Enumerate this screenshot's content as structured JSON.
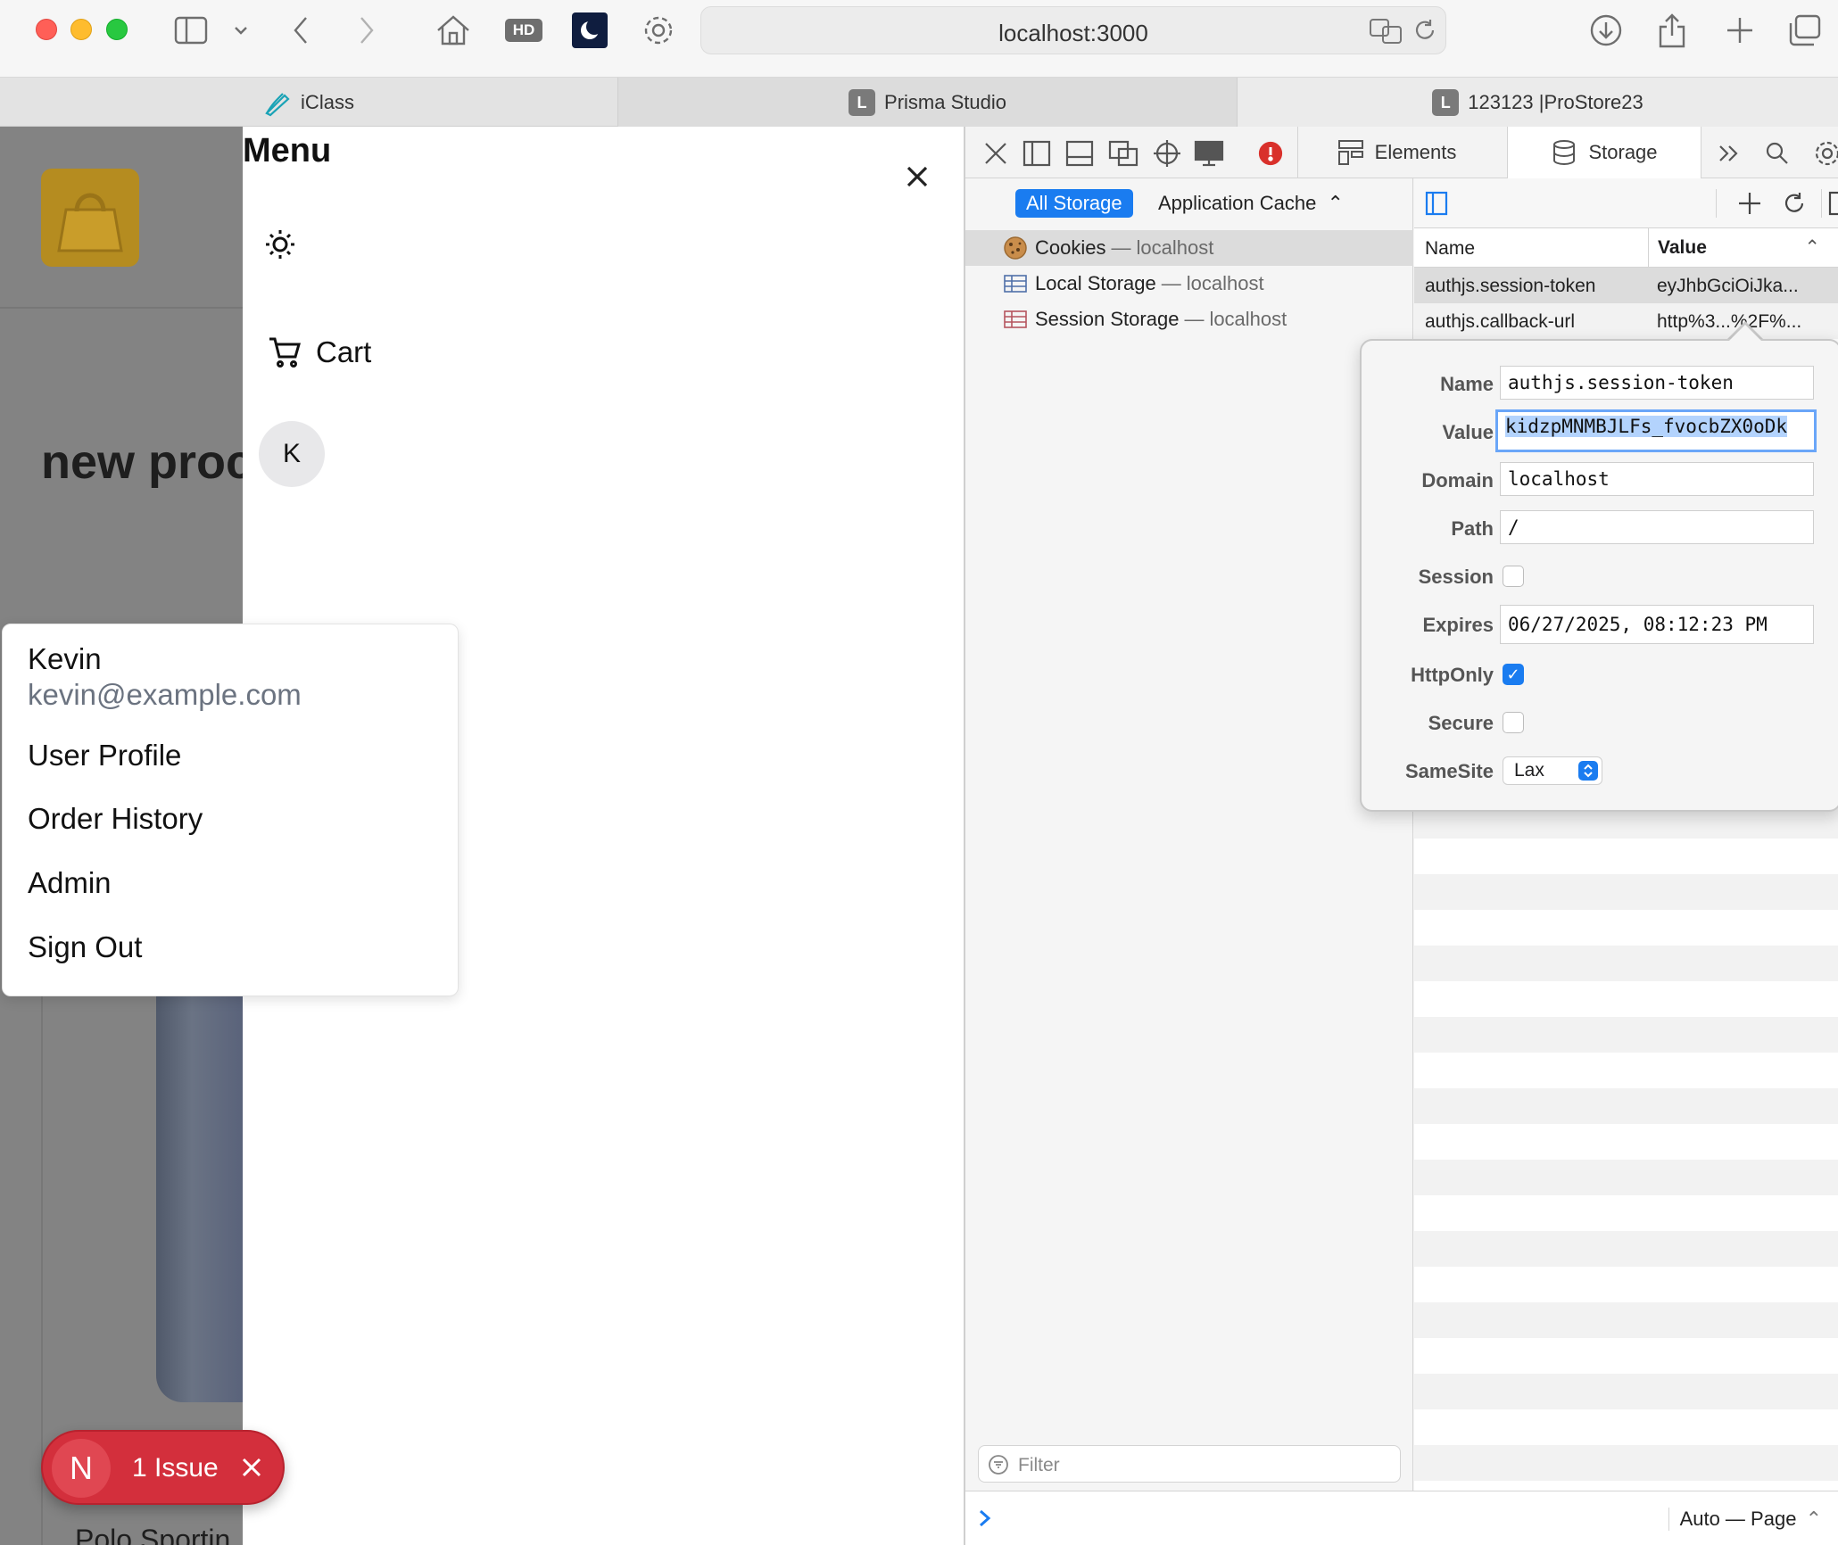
{
  "browser": {
    "url": "localhost:3000",
    "tabs": [
      {
        "label": "iClass",
        "icon": "pen-icon"
      },
      {
        "label": "Prisma Studio",
        "favicon": "L"
      },
      {
        "label": "123123 |ProStore23",
        "favicon": "L"
      }
    ],
    "hd_badge": "HD"
  },
  "app": {
    "heading_partial": "new proc",
    "product_partial": "Polo Sportin",
    "drawer": {
      "title": "Menu",
      "cart_label": "Cart",
      "avatar_initial": "K"
    },
    "user_menu": {
      "name": "Kevin",
      "email": "kevin@example.com",
      "items": [
        "User Profile",
        "Order History",
        "Admin",
        "Sign Out"
      ]
    },
    "issue_badge": {
      "letter": "N",
      "label": "1 Issue"
    }
  },
  "devtools": {
    "tabs": {
      "elements": "Elements",
      "storage": "Storage"
    },
    "sidebar": {
      "scope_selected": "All Storage",
      "scope_other": "Application Cache",
      "items": [
        {
          "label": "Cookies",
          "host": "localhost",
          "selected": true
        },
        {
          "label": "Local Storage",
          "host": "localhost",
          "selected": false
        },
        {
          "label": "Session Storage",
          "host": "localhost",
          "selected": false
        }
      ],
      "host_separator": "—",
      "filter_placeholder": "Filter"
    },
    "table": {
      "columns": {
        "name": "Name",
        "value": "Value"
      },
      "rows": [
        {
          "name": "authjs.session-token",
          "value": "eyJhbGciOiJka..."
        },
        {
          "name": "authjs.callback-url",
          "value": "http%3...%2F%..."
        }
      ]
    },
    "cookie_editor": {
      "labels": {
        "name": "Name",
        "value": "Value",
        "domain": "Domain",
        "path": "Path",
        "session": "Session",
        "expires": "Expires",
        "httponly": "HttpOnly",
        "secure": "Secure",
        "samesite": "SameSite"
      },
      "name": "authjs.session-token",
      "value": "kidzpMNMBJLFs_fvocbZX0oDk",
      "domain": "localhost",
      "path": "/",
      "session": false,
      "expires": "06/27/2025, 08:12:23 PM",
      "httponly": true,
      "secure": false,
      "samesite": "Lax"
    },
    "console": {
      "context": "Auto — Page"
    }
  },
  "colors": {
    "accent": "#1a7cf0",
    "issue_red": "#d32f3c",
    "logo_gold": "#b58c20"
  }
}
